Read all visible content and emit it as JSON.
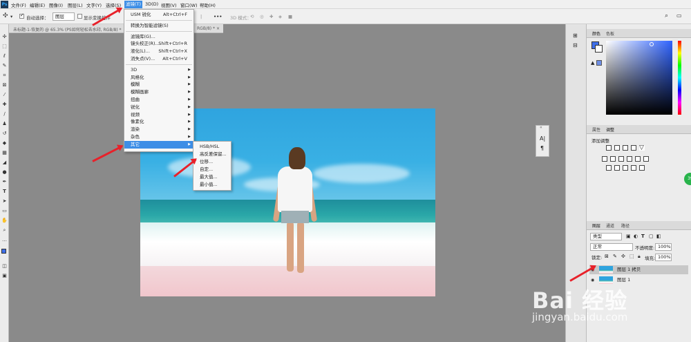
{
  "app": {
    "logo": "Ps"
  },
  "menubar": {
    "items": [
      "文件(F)",
      "编辑(E)",
      "图像(I)",
      "图层(L)",
      "文字(Y)",
      "选择(S)",
      "滤镜(T)",
      "3D(D)",
      "视图(V)",
      "窗口(W)",
      "帮助(H)"
    ]
  },
  "options": {
    "auto_select_label": "自动选择：",
    "auto_select_value": "图层",
    "show_transform_label": "显示变换控件",
    "mode_3d_label": "3D 模式：",
    "more": "•••"
  },
  "document_tab": {
    "title": "未标题-1-恢复的 @ 65.3% (PS如何轻松去水印, RGB/8) *",
    "tab2": "RGB/8) *"
  },
  "filter_menu": {
    "items": [
      {
        "label": "USM 锐化",
        "shortcut": "Alt+Ctrl+F"
      },
      {
        "sep": true
      },
      {
        "label": "转换为智能滤镜(S)"
      },
      {
        "sep": true
      },
      {
        "label": "滤镜库(G)..."
      },
      {
        "label": "镜头校正(R)...",
        "shortcut": "Shift+Ctrl+R"
      },
      {
        "label": "液化(L)...",
        "shortcut": "Shift+Ctrl+X"
      },
      {
        "label": "消失点(V)...",
        "shortcut": "Alt+Ctrl+V"
      },
      {
        "sep": true
      },
      {
        "label": "3D",
        "sub": true
      },
      {
        "label": "风格化",
        "sub": true
      },
      {
        "label": "模糊",
        "sub": true
      },
      {
        "label": "模糊画廊",
        "sub": true
      },
      {
        "label": "扭曲",
        "sub": true
      },
      {
        "label": "锐化",
        "sub": true
      },
      {
        "label": "视频",
        "sub": true
      },
      {
        "label": "像素化",
        "sub": true
      },
      {
        "label": "渲染",
        "sub": true
      },
      {
        "label": "杂色",
        "sub": true
      },
      {
        "label": "其它",
        "sub": true,
        "highlight": true
      }
    ]
  },
  "other_submenu": {
    "items": [
      "HSB/HSL",
      "高反差保留...",
      "位移...",
      "自定...",
      "最大值...",
      "最小值..."
    ]
  },
  "color_panel": {
    "tab1": "颜色",
    "tab2": "色板"
  },
  "adjust_panel": {
    "tab1": "属性",
    "tab2": "调整",
    "add_label": "添加调整"
  },
  "layers_panel": {
    "tab1": "图层",
    "tab2": "通道",
    "tab3": "路径",
    "kind": "类型",
    "blend": "正常",
    "opacity_label": "不透明度:",
    "opacity": "100%",
    "lock_label": "锁定:",
    "fill_label": "填充:",
    "fill": "100%",
    "layers": [
      {
        "name": "图层 1 拷贝",
        "selected": true
      },
      {
        "name": "图层 1",
        "selected": false
      }
    ]
  },
  "char_panel": {
    "icon1": "A|",
    "icon2": "¶"
  },
  "badge": {
    "text": "39"
  },
  "watermark": {
    "brand": "Bai 经验",
    "url": "jingyan.baidu.com"
  },
  "colors": {
    "accent": "#3d8ee6",
    "arrow": "#e8212a"
  }
}
